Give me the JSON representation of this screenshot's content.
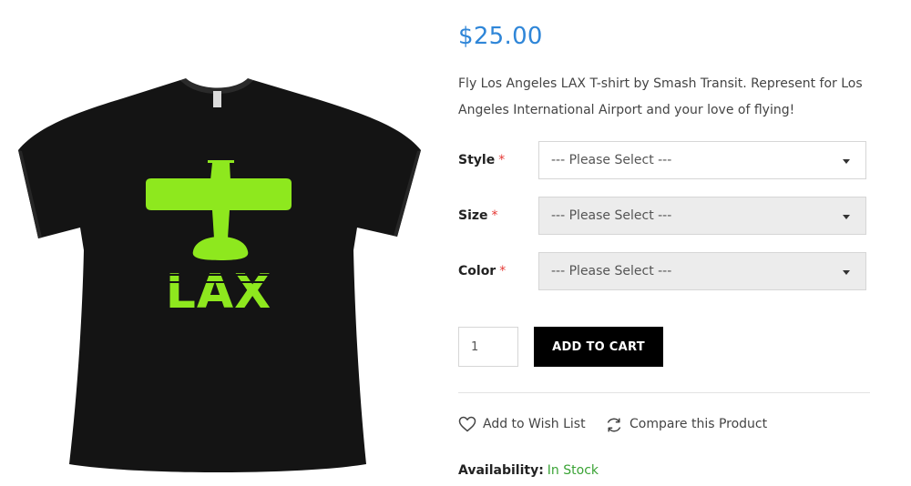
{
  "product": {
    "price": "$25.00",
    "description": "Fly Los Angeles LAX T-shirt by Smash Transit. Represent for Los Angeles International Airport and your love of flying!",
    "image": {
      "shirt_color": "#141414",
      "print_color": "#8ee81e",
      "print_text": "LAX"
    }
  },
  "options": [
    {
      "label": "Style",
      "required_mark": "*",
      "value": "--- Please Select ---",
      "enabled": true
    },
    {
      "label": "Size",
      "required_mark": "*",
      "value": "--- Please Select ---",
      "enabled": false
    },
    {
      "label": "Color",
      "required_mark": "*",
      "value": "--- Please Select ---",
      "enabled": false
    }
  ],
  "cart": {
    "quantity": "1",
    "add_label": "ADD TO CART"
  },
  "actions": {
    "wishlist_label": "Add to Wish List",
    "compare_label": "Compare this Product"
  },
  "availability": {
    "label": "Availability:",
    "value": "In Stock"
  },
  "colors": {
    "price": "#2f86d8",
    "required": "#e53935",
    "in_stock": "#3aa335",
    "button": "#000000"
  }
}
